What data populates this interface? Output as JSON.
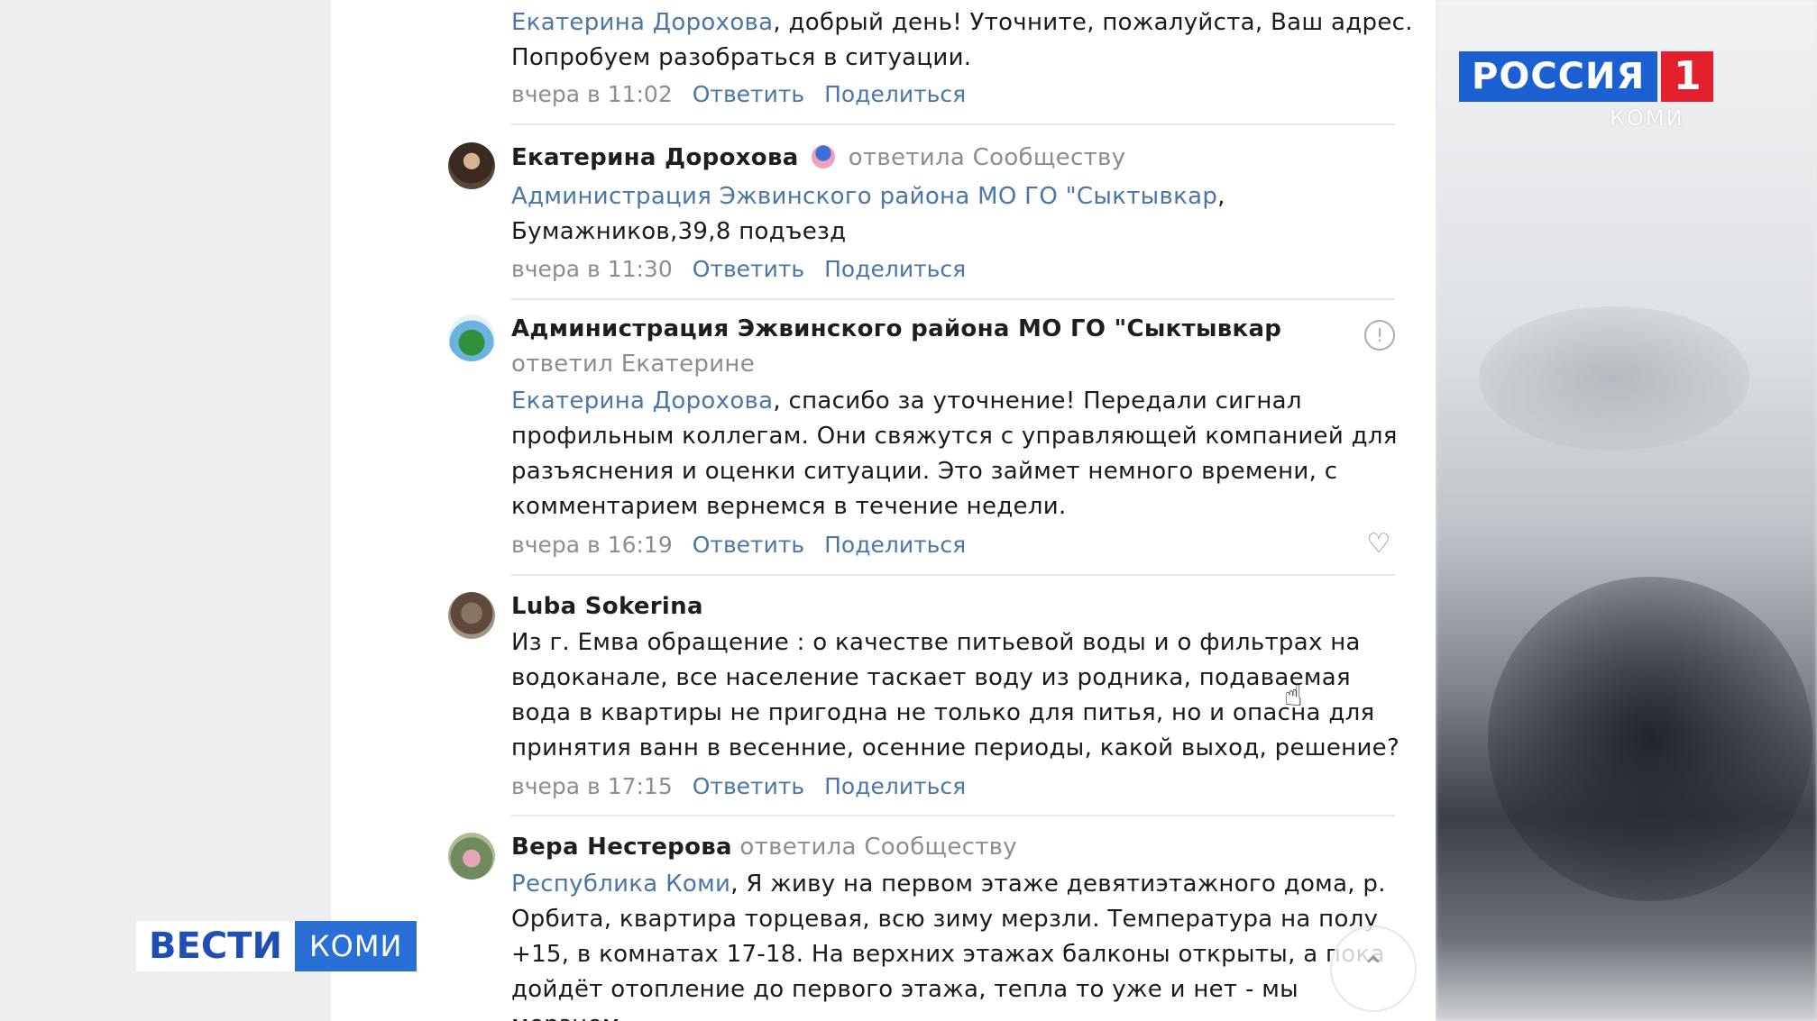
{
  "comments": [
    {
      "text_link": "Екатерина Дорохова",
      "text": ", добрый день! Уточните, пожалуйста, Ваш адрес. Попробуем разобраться в ситуации.",
      "time": "вчера в 11:02",
      "reply": "Ответить",
      "share": "Поделиться"
    },
    {
      "author": "Екатерина Дорохова",
      "action": "ответила Сообществу",
      "text_link": "Администрация Эжвинского района МО ГО \"Сыктывкар",
      "text": ", Бумажников,39,8 подъезд",
      "time": "вчера в 11:30",
      "reply": "Ответить",
      "share": "Поделиться"
    },
    {
      "author": "Администрация Эжвинского района МО ГО \"Сыктывкар",
      "action": "ответил Екатерине",
      "text_link": "Екатерина Дорохова",
      "text": ", спасибо за уточнение! Передали сигнал профильным коллегам. Они свяжутся с управляющей компанией для разъяснения и оценки ситуации. Это займет немного времени, с комментарием вернемся в течение недели.",
      "time": "вчера в 16:19",
      "reply": "Ответить",
      "share": "Поделиться"
    },
    {
      "author": "Luba Sokerina",
      "text": "Из г. Емва обращение : о качестве питьевой воды и о фильтрах на водоканале, все население таскает воду из родника, подаваемая вода в квартиры не пригодна не только для питья, но и опасна для принятия ванн в весенние, осенние периоды, какой выход, решение?",
      "time": "вчера в 17:15",
      "reply": "Ответить",
      "share": "Поделиться"
    },
    {
      "author": "Вера Нестерова",
      "action": "ответила Сообществу",
      "text_link": "Республика Коми",
      "text": ", Я живу на первом этаже девятиэтажного дома, р. Орбита, квартира торцевая, всю зиму мерзли. Температура на полу +15, в комнатах 17-18. На верхних этажах балконы открыты, а пока дойдёт отопление до первого этажа, тепла то уже и нет - мы мерзнем"
    }
  ],
  "icons": {
    "report": "!",
    "like": "♡",
    "scroll_top": "⌃",
    "cursor": "☝"
  },
  "overlay": {
    "channel": "РОССИЯ",
    "channel_num": "1",
    "region": "КОМИ",
    "program": "ВЕСТИ",
    "program_region": "КОМИ"
  },
  "colors": {
    "link": "#4a76a8",
    "muted": "#8a8e94",
    "channel_blue": "#1c5fd1",
    "channel_red": "#e3202b"
  }
}
